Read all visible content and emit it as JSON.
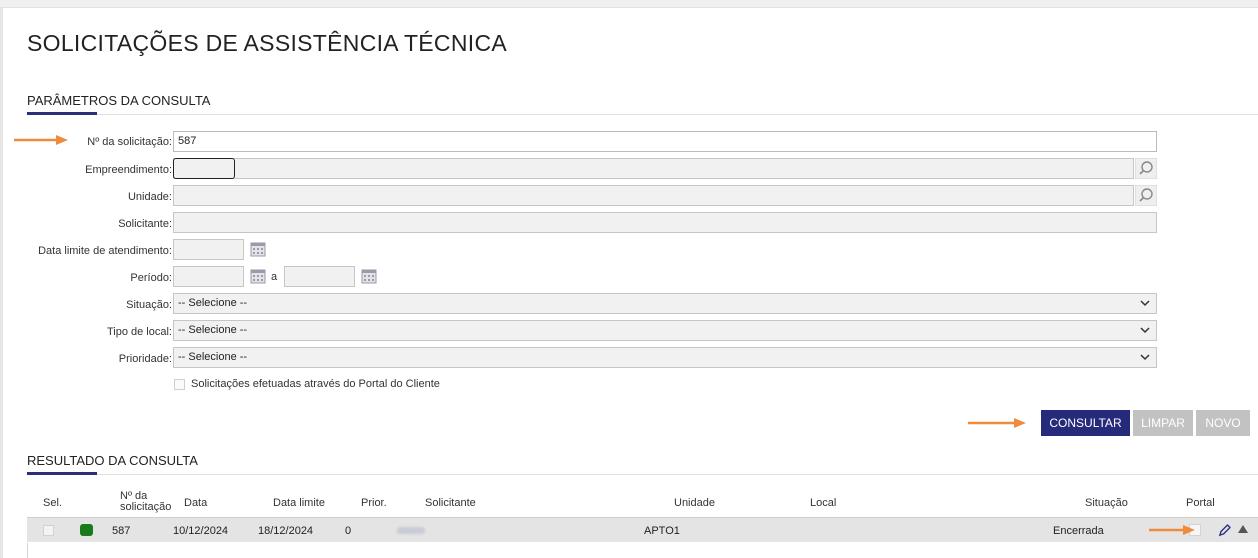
{
  "page": {
    "title": "SOLICITAÇÕES DE ASSISTÊNCIA TÉCNICA"
  },
  "params": {
    "section_title": "PARÂMETROS DA CONSULTA",
    "numero_label": "Nº da solicitação:",
    "numero_value": "587",
    "empreendimento_label": "Empreendimento:",
    "unidade_label": "Unidade:",
    "solicitante_label": "Solicitante:",
    "data_limite_label": "Data limite de atendimento:",
    "periodo_label": "Período:",
    "periodo_sep": "a",
    "situacao_label": "Situação:",
    "situacao_value": "-- Selecione --",
    "tipo_local_label": "Tipo de local:",
    "tipo_local_value": "-- Selecione --",
    "prioridade_label": "Prioridade:",
    "prioridade_value": "-- Selecione --",
    "portal_checkbox_label": "Solicitações efetuadas através do Portal do Cliente",
    "portal_checkbox_checked": false
  },
  "actions": {
    "consultar": "CONSULTAR",
    "limpar": "LIMPAR",
    "novo": "NOVO"
  },
  "results": {
    "section_title": "RESULTADO DA CONSULTA",
    "columns": {
      "sel": "Sel.",
      "numero_line1": "Nº da",
      "numero_line2": "solicitação",
      "data": "Data",
      "data_limite": "Data limite",
      "prior": "Prior.",
      "solicitante": "Solicitante",
      "unidade": "Unidade",
      "local": "Local",
      "situacao": "Situação",
      "portal": "Portal"
    },
    "rows": [
      {
        "numero": "587",
        "data": "10/12/2024",
        "data_limite": "18/12/2024",
        "prioridade": "0",
        "unidade": "APTO1",
        "situacao": "Encerrada"
      }
    ]
  },
  "colors": {
    "accent": "#262a7a",
    "arrow": "#f08a3c",
    "status_green": "#1a7a1a",
    "button_disabled": "#c2c2c2"
  }
}
